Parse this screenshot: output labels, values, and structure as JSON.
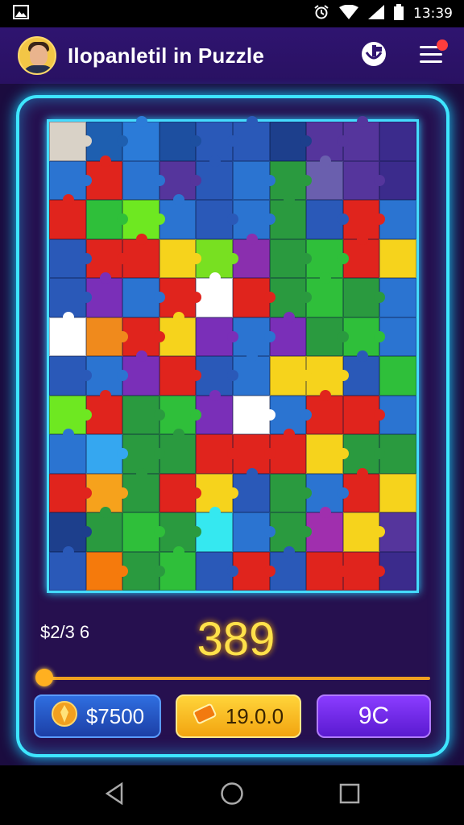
{
  "status_bar": {
    "time": "13:39",
    "icons": [
      "gallery-icon",
      "alarm-icon",
      "wifi-icon",
      "signal-icon",
      "battery-icon"
    ]
  },
  "app_bar": {
    "title": "Ilopanletil in Puzzle",
    "icons": [
      "avatar",
      "trophy-icon",
      "menu-icon"
    ]
  },
  "score": {
    "left_value": "$2/3 6",
    "center_value": "389"
  },
  "progress": {
    "level": 0
  },
  "buttons": {
    "coins_label": "$7500",
    "gold_label": "19.0.0",
    "purple_label": "9C"
  },
  "colors": {
    "accent_cyan": "#3ee6ff",
    "board_bg": "#26104f",
    "app_bar": "#2f1470",
    "score_yellow": "#ffe14a"
  },
  "puzzle": {
    "rows": 12,
    "cols": 10,
    "pieces": [
      "#d9d2c7",
      "#1e5fb0",
      "#2b7bd8",
      "#1d4fa0",
      "#2a59b8",
      "#2a59b8",
      "#1d3f8c",
      "#55359c",
      "#55359c",
      "#3b2b8c",
      "#2b74d1",
      "#e0241d",
      "#2b74d1",
      "#55359c",
      "#2a59b8",
      "#2b74d1",
      "#2a9a3f",
      "#6a5fae",
      "#55359c",
      "#3b2b8c",
      "#e0241d",
      "#2fbf3a",
      "#6ee821",
      "#2b74d1",
      "#2a59b8",
      "#2b74d1",
      "#2a9a3f",
      "#2a59b8",
      "#e0241d",
      "#2b74d1",
      "#2a59b8",
      "#e0241d",
      "#e0241d",
      "#f6d31c",
      "#78e021",
      "#8a2fae",
      "#2a9a3f",
      "#2fbf3a",
      "#e0241d",
      "#f6d31c",
      "#2a59b8",
      "#7a2fb8",
      "#2b74d1",
      "#e0241d",
      "#ffffff",
      "#e0241d",
      "#2a9a3f",
      "#2fbf3a",
      "#2a9a3f",
      "#2b74d1",
      "#ffffff",
      "#f08a1c",
      "#e0241d",
      "#f6d31c",
      "#7a2fb8",
      "#2b74d1",
      "#7a2fb8",
      "#2a9a3f",
      "#2fbf3a",
      "#2b74d1",
      "#2a59b8",
      "#2b74d1",
      "#7a2fb8",
      "#e0241d",
      "#2a59b8",
      "#2b74d1",
      "#f6d31c",
      "#f6d31c",
      "#2a59b8",
      "#2fbf3a",
      "#6ee821",
      "#e0241d",
      "#2a9a3f",
      "#2fbf3a",
      "#7a2fb8",
      "#ffffff",
      "#2b74d1",
      "#e0241d",
      "#e0241d",
      "#2b74d1",
      "#2b74d1",
      "#35a7f0",
      "#2a9a3f",
      "#2a9a3f",
      "#e0241d",
      "#e0241d",
      "#e0241d",
      "#f6d31c",
      "#2a9a3f",
      "#2a9a3f",
      "#e0241d",
      "#f6a21c",
      "#2a9a3f",
      "#e0241d",
      "#f6d31c",
      "#2a59b8",
      "#2a9a3f",
      "#2b74d1",
      "#e0241d",
      "#f6d31c",
      "#1d3f8c",
      "#2a9a3f",
      "#2fbf3a",
      "#2a9a3f",
      "#35e8f0",
      "#2b74d1",
      "#2a9a3f",
      "#a02fae",
      "#f6d31c",
      "#55359c",
      "#2a59b8",
      "#f57a0c",
      "#2a9a3f",
      "#2fbf3a",
      "#2a59b8",
      "#e0241d",
      "#2a59b8",
      "#e0241d",
      "#e0241d",
      "#3b2b8c"
    ]
  },
  "nav_bar": {
    "icons": [
      "back-icon",
      "home-icon",
      "recents-icon"
    ]
  }
}
